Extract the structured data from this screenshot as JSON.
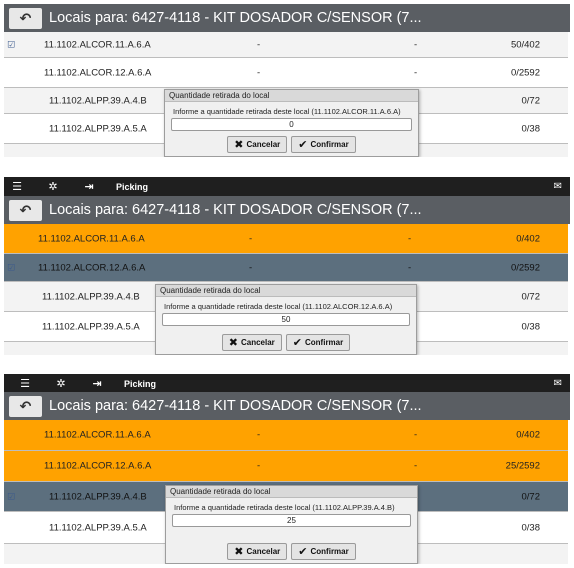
{
  "appbar": {
    "title": "Picking",
    "icons": [
      "list-icon",
      "gear-icon",
      "exit-icon",
      "mail-icon"
    ]
  },
  "header": {
    "back_icon": "↶",
    "title": "Locais para: 6427-4118 - KIT DOSADOR C/SENSOR (7..."
  },
  "dialog": {
    "title": "Quantidade retirada do local",
    "cancel_label": "Cancelar",
    "confirm_label": "Confirmar",
    "cancel_icon": "✖",
    "confirm_icon": "✔"
  },
  "panels": [
    {
      "rows": [
        {
          "location": "11.1102.ALCOR.11.A.6.A",
          "dash1": "-",
          "dash2": "-",
          "qty": "50/402",
          "checked": "☑"
        },
        {
          "location": "11.1102.ALCOR.12.A.6.A",
          "dash1": "-",
          "dash2": "-",
          "qty": "0/2592"
        },
        {
          "location": "11.1102.ALPP.39.A.4.B",
          "qty": "0/72"
        },
        {
          "location": "11.1102.ALPP.39.A.5.A",
          "qty": "0/38"
        }
      ],
      "dialog_message": "Informe a quantidade retirada deste local (11.1102.ALCOR.11.A.6.A)",
      "dialog_value": "0"
    },
    {
      "rows": [
        {
          "location": "11.1102.ALCOR.11.A.6.A",
          "dash1": "-",
          "dash2": "-",
          "qty": "0/402"
        },
        {
          "location": "11.1102.ALCOR.12.A.6.A",
          "dash1": "-",
          "dash2": "-",
          "qty": "0/2592",
          "checked": "☑"
        },
        {
          "location": "11.1102.ALPP.39.A.4.B",
          "qty": "0/72"
        },
        {
          "location": "11.1102.ALPP.39.A.5.A",
          "qty": "0/38"
        }
      ],
      "dialog_message": "Informe a quantidade retirada deste local (11.1102.ALCOR.12.A.6.A)",
      "dialog_value": "50"
    },
    {
      "rows": [
        {
          "location": "11.1102.ALCOR.11.A.6.A",
          "dash1": "-",
          "dash2": "-",
          "qty": "0/402"
        },
        {
          "location": "11.1102.ALCOR.12.A.6.A",
          "dash1": "-",
          "dash2": "-",
          "qty": "25/2592"
        },
        {
          "location": "11.1102.ALPP.39.A.4.B",
          "qty": "0/72",
          "checked": "☑"
        },
        {
          "location": "11.1102.ALPP.39.A.5.A",
          "qty": "0/38"
        }
      ],
      "dialog_message": "Informe a quantidade retirada deste local (11.1102.ALPP.39.A.4.B)",
      "dialog_value": "25"
    }
  ]
}
